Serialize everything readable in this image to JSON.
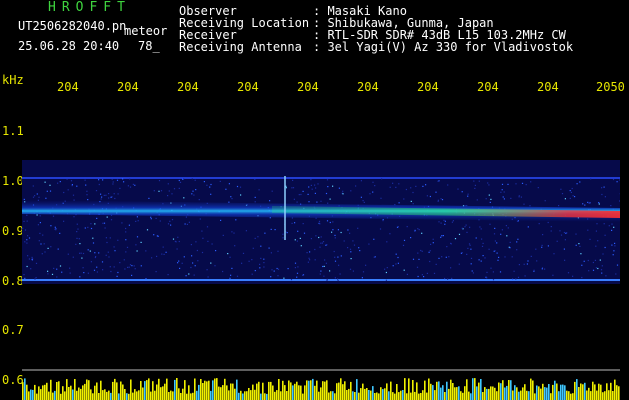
{
  "header": {
    "brand": "HROFFT",
    "filename": "UT2506282040.pn",
    "mode": "meteor",
    "datetime": "25.06.28 20:40",
    "count": "78_"
  },
  "info": {
    "labels": [
      "Observer",
      "Receiving Location",
      "Receiver",
      "Receiving Antenna"
    ],
    "values": [
      ": Masaki Kano",
      ": Shibukawa, Gunma, Japan",
      ": RTL-SDR SDR# 43dB L15 103.2MHz CW",
      ": 3el Yagi(V) Az 330 for Vladivostok"
    ]
  },
  "axis": {
    "unit": "kHz",
    "time_ticks": [
      "204",
      "204",
      "204",
      "204",
      "204",
      "204",
      "204",
      "204",
      "204",
      "2050"
    ],
    "freq_ticks": [
      "1.1",
      "1.0",
      "0.9",
      "0.8",
      "0.7",
      "0.6"
    ]
  },
  "colors": {
    "background": "#000000",
    "header_brand": "#3fd43f",
    "text": "#ffffff",
    "axis": "#e6e600",
    "signal_band": "#ff3030"
  }
}
